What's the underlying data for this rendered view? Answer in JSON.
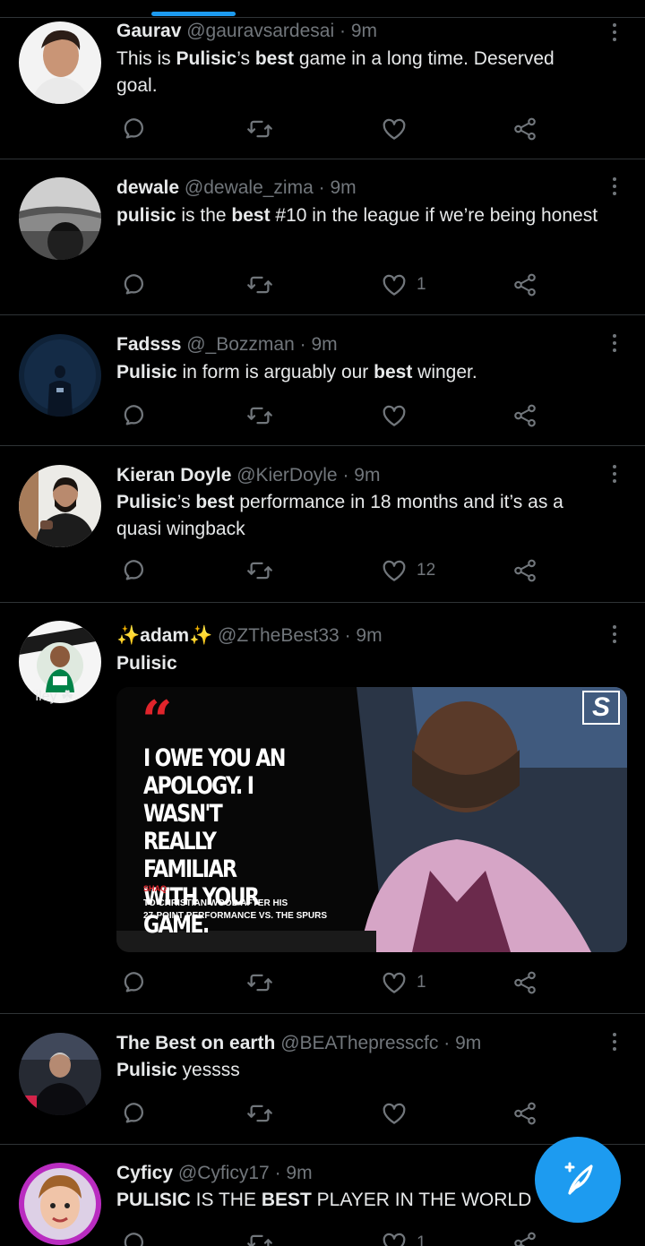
{
  "colors": {
    "accent": "#1d9bf0",
    "background": "#000000",
    "text": "#e7e9ea",
    "muted": "#71767b",
    "divider": "#2f3336"
  },
  "tweets": [
    {
      "name": "Gaurav",
      "handle": "@gauravsardesai",
      "time": "9m",
      "segments": [
        {
          "t": "This is "
        },
        {
          "t": "Pulisic",
          "b": true
        },
        {
          "t": "’s "
        },
        {
          "t": "best",
          "b": true
        },
        {
          "t": " game in a long time. Deserved goal."
        }
      ],
      "likes": ""
    },
    {
      "name": "dewale",
      "handle": "@dewale_zima",
      "time": "9m",
      "segments": [
        {
          "t": "pulisic",
          "b": true
        },
        {
          "t": " is the "
        },
        {
          "t": "best",
          "b": true
        },
        {
          "t": " #10 in the league if we’re being honest"
        }
      ],
      "likes": "1"
    },
    {
      "name": "Fadsss",
      "handle": "@_Bozzman",
      "time": "9m",
      "segments": [
        {
          "t": "Pulisic",
          "b": true
        },
        {
          "t": " in form is arguably our "
        },
        {
          "t": "best",
          "b": true
        },
        {
          "t": " winger."
        }
      ],
      "likes": ""
    },
    {
      "name": "Kieran Doyle",
      "handle": "@KierDoyle",
      "time": "9m",
      "segments": [
        {
          "t": "Pulisic",
          "b": true
        },
        {
          "t": "’s "
        },
        {
          "t": "best",
          "b": true
        },
        {
          "t": " performance in 18 months and it’s as a quasi wingback"
        }
      ],
      "likes": "12"
    },
    {
      "name": "✨adam✨",
      "handle": "@ZTheBest33",
      "time": "9m",
      "segments": [
        {
          "t": "Pulisic",
          "b": true
        }
      ],
      "avatar_caption": "ʻiley ☘",
      "media": {
        "quote_mark": "“",
        "quote": "I owe you an\napology. I wasn't\nreally familiar\nwith your game.",
        "speaker": "SHAQ",
        "subtitle": "TO CHRISTIAN WOOD AFTER HIS\n27-POINT PERFORMANCE VS. THE SPURS",
        "logo": "S"
      },
      "likes": "1"
    },
    {
      "name": "The Best on earth",
      "handle": "@BEAThepresscfc",
      "time": "9m",
      "segments": [
        {
          "t": "Pulisic",
          "b": true
        },
        {
          "t": " yessss"
        }
      ],
      "likes": ""
    },
    {
      "name": "Cyficy",
      "handle": "@Cyficy17",
      "time": "9m",
      "segments": [
        {
          "t": "PULISIC",
          "b": true
        },
        {
          "t": " IS THE "
        },
        {
          "t": "BEST",
          "b": true
        },
        {
          "t": " PLAYER IN THE WORLD"
        }
      ],
      "likes": "1"
    }
  ],
  "compose": {
    "icon": "compose-tweet-icon",
    "plus": "+"
  }
}
